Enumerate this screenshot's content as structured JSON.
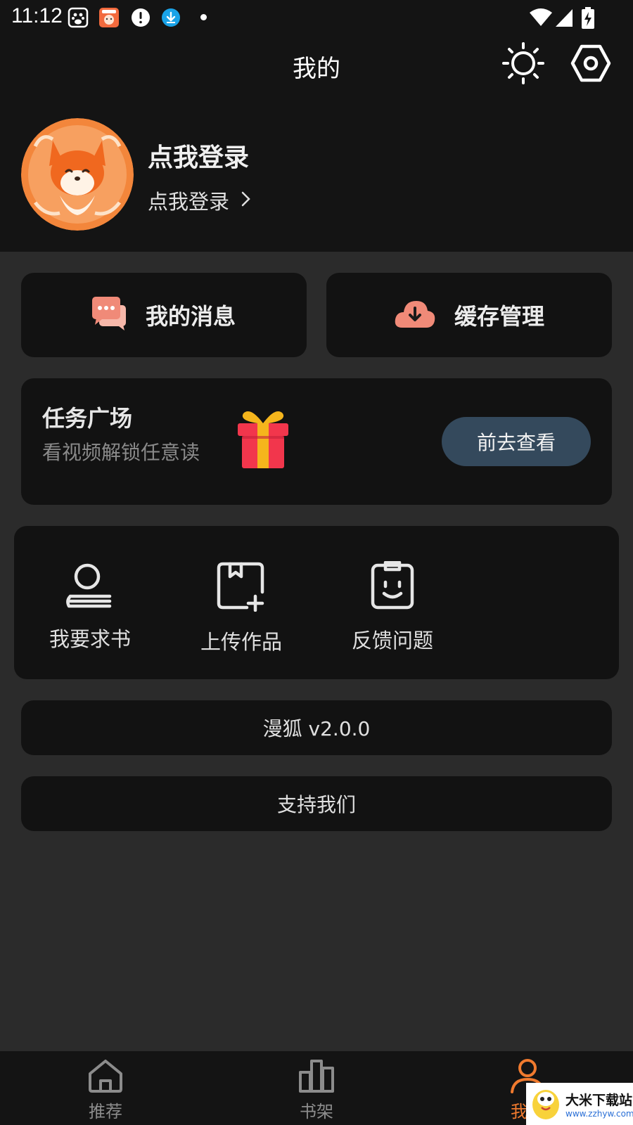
{
  "status_bar": {
    "time": "11:12"
  },
  "header": {
    "title": "我的"
  },
  "profile": {
    "name": "点我登录",
    "login_link": "点我登录"
  },
  "quick_actions": [
    {
      "label": "我的消息"
    },
    {
      "label": "缓存管理"
    }
  ],
  "task": {
    "title": "任务广场",
    "subtitle": "看视频解锁任意读",
    "button": "前去查看"
  },
  "tools": [
    {
      "label": "我要求书"
    },
    {
      "label": "上传作品"
    },
    {
      "label": "反馈问题"
    }
  ],
  "version": "漫狐 v2.0.0",
  "support": "支持我们",
  "bottom_nav": [
    {
      "label": "推荐",
      "active": false
    },
    {
      "label": "书架",
      "active": false
    },
    {
      "label": "我的",
      "active": true
    }
  ],
  "watermark": {
    "text": "大米下载站",
    "url": "www.zzhyw.com"
  },
  "colors": {
    "accent": "#f07a2e",
    "button_bg": "#34495c",
    "icon_salmon": "#f08a78"
  }
}
